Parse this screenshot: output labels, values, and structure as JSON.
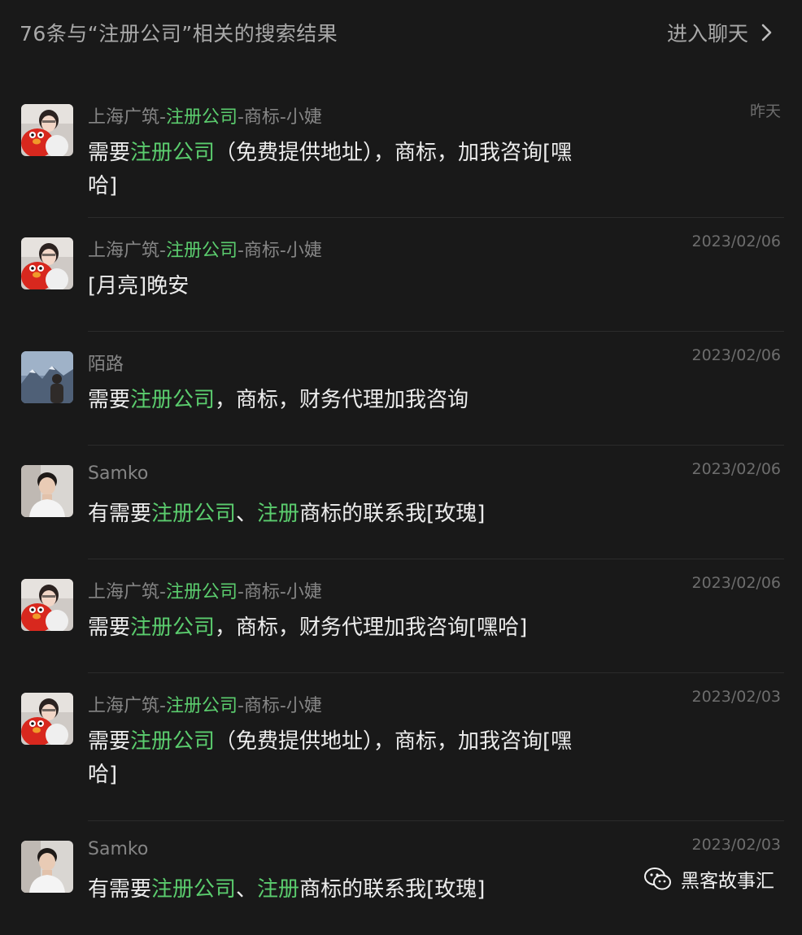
{
  "header": {
    "title": "76条与“注册公司”相关的搜索结果",
    "enter_chat": "进入聊天"
  },
  "results": [
    {
      "avatar": "avatar-girl-red-plush",
      "sender": [
        {
          "t": "上海广筑-"
        },
        {
          "t": "注册公司",
          "hl": true
        },
        {
          "t": "-商标-小婕"
        }
      ],
      "date": "昨天",
      "message": [
        {
          "t": "需要"
        },
        {
          "t": "注册公司",
          "hl": true
        },
        {
          "t": "（免费提供地址），商标，加我咨询[嘿哈]"
        }
      ]
    },
    {
      "avatar": "avatar-girl-red-plush",
      "sender": [
        {
          "t": "上海广筑-"
        },
        {
          "t": "注册公司",
          "hl": true
        },
        {
          "t": "-商标-小婕"
        }
      ],
      "date": "2023/02/06",
      "message": [
        {
          "t": "[月亮]晚安"
        }
      ]
    },
    {
      "avatar": "avatar-mountain-person",
      "sender": [
        {
          "t": "陌路"
        }
      ],
      "date": "2023/02/06",
      "message": [
        {
          "t": "需要"
        },
        {
          "t": "注册公司",
          "hl": true
        },
        {
          "t": "，商标，财务代理加我咨询"
        }
      ]
    },
    {
      "avatar": "avatar-young-man",
      "sender": [
        {
          "t": "Samko"
        }
      ],
      "date": "2023/02/06",
      "message": [
        {
          "t": "有需要"
        },
        {
          "t": "注册公司",
          "hl": true
        },
        {
          "t": "、"
        },
        {
          "t": "注册",
          "hl": true
        },
        {
          "t": "商标的联系我[玫瑰]"
        }
      ]
    },
    {
      "avatar": "avatar-girl-red-plush",
      "sender": [
        {
          "t": "上海广筑-"
        },
        {
          "t": "注册公司",
          "hl": true
        },
        {
          "t": "-商标-小婕"
        }
      ],
      "date": "2023/02/06",
      "message": [
        {
          "t": "需要"
        },
        {
          "t": "注册公司",
          "hl": true
        },
        {
          "t": "，商标，财务代理加我咨询[嘿哈]"
        }
      ]
    },
    {
      "avatar": "avatar-girl-red-plush",
      "sender": [
        {
          "t": "上海广筑-"
        },
        {
          "t": "注册公司",
          "hl": true
        },
        {
          "t": "-商标-小婕"
        }
      ],
      "date": "2023/02/03",
      "message": [
        {
          "t": "需要"
        },
        {
          "t": "注册公司",
          "hl": true
        },
        {
          "t": "（免费提供地址），商标，加我咨询[嘿哈]"
        }
      ]
    },
    {
      "avatar": "avatar-young-man",
      "sender": [
        {
          "t": "Samko"
        }
      ],
      "date": "2023/02/03",
      "message": [
        {
          "t": "有需要"
        },
        {
          "t": "注册公司",
          "hl": true
        },
        {
          "t": "、"
        },
        {
          "t": "注册",
          "hl": true
        },
        {
          "t": "商标的联系我[玫瑰]"
        }
      ]
    }
  ],
  "watermark": {
    "icon": "wechat-icon",
    "text": "黑客故事汇"
  },
  "colors": {
    "background": "#191919",
    "highlight": "#5bcd6e",
    "muted": "#858585"
  }
}
